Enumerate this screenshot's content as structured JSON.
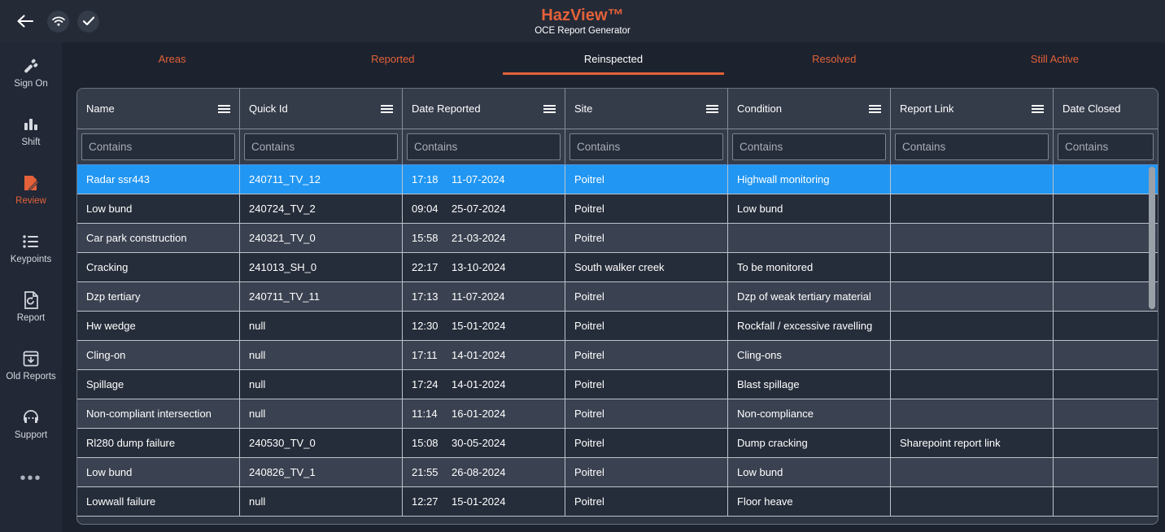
{
  "topbar": {
    "back_icon": "back-arrow-icon",
    "wifi_icon": "wifi-icon",
    "check_icon": "check-icon",
    "brand_title": "HazView™",
    "brand_subtitle": "OCE Report Generator",
    "brand_color": "#e4613a"
  },
  "sidebar": {
    "items": [
      {
        "label": "Sign On",
        "icon": "sign-on-icon",
        "active": false
      },
      {
        "label": "Shift",
        "icon": "bar-chart-icon",
        "active": false
      },
      {
        "label": "Review",
        "icon": "edit-document-icon",
        "active": true
      },
      {
        "label": "Keypoints",
        "icon": "list-icon",
        "active": false
      },
      {
        "label": "Report",
        "icon": "document-refresh-icon",
        "active": false
      },
      {
        "label": "Old Reports",
        "icon": "archive-download-icon",
        "active": false
      },
      {
        "label": "Support",
        "icon": "headset-icon",
        "active": false
      }
    ],
    "more_label": "•••",
    "active_color": "#e4613a"
  },
  "tabs": [
    {
      "label": "Areas",
      "active": false
    },
    {
      "label": "Reported",
      "active": false
    },
    {
      "label": "Reinspected",
      "active": true
    },
    {
      "label": "Resolved",
      "active": false
    },
    {
      "label": "Still Active",
      "active": false
    }
  ],
  "grid": {
    "columns": [
      {
        "label": "Name",
        "menu_icon": "column-menu-icon",
        "has_menu": true
      },
      {
        "label": "Quick Id",
        "menu_icon": "column-menu-icon",
        "has_menu": true
      },
      {
        "label": "Date Reported",
        "menu_icon": "column-menu-icon",
        "has_menu": true
      },
      {
        "label": "Site",
        "menu_icon": "column-menu-icon",
        "has_menu": true
      },
      {
        "label": "Condition",
        "menu_icon": "column-menu-icon",
        "has_menu": true
      },
      {
        "label": "Report Link",
        "menu_icon": "column-menu-icon",
        "has_menu": true
      },
      {
        "label": "Date Closed",
        "menu_icon": "column-menu-icon",
        "has_menu": false
      }
    ],
    "filter_placeholder": "Contains",
    "filter_values": [
      "",
      "",
      "",
      "",
      "",
      "",
      ""
    ],
    "selected_row_index": 0,
    "selected_row_color": "#2196f3",
    "rows": [
      {
        "name": "Radar ssr443",
        "quick_id": "240711_TV_12",
        "time": "17:18",
        "date": "11-07-2024",
        "site": "Poitrel",
        "condition": "Highwall monitoring",
        "report_link": "",
        "date_closed": ""
      },
      {
        "name": "Low bund",
        "quick_id": "240724_TV_2",
        "time": "09:04",
        "date": "25-07-2024",
        "site": "Poitrel",
        "condition": "Low bund",
        "report_link": "",
        "date_closed": ""
      },
      {
        "name": "Car park construction",
        "quick_id": "240321_TV_0",
        "time": "15:58",
        "date": "21-03-2024",
        "site": "Poitrel",
        "condition": "",
        "report_link": "",
        "date_closed": ""
      },
      {
        "name": "Cracking",
        "quick_id": "241013_SH_0",
        "time": "22:17",
        "date": "13-10-2024",
        "site": "South walker creek",
        "condition": "To be monitored",
        "report_link": "",
        "date_closed": ""
      },
      {
        "name": "Dzp tertiary",
        "quick_id": "240711_TV_11",
        "time": "17:13",
        "date": "11-07-2024",
        "site": "Poitrel",
        "condition": "Dzp of weak tertiary material",
        "report_link": "",
        "date_closed": ""
      },
      {
        "name": "Hw wedge",
        "quick_id": "null",
        "time": "12:30",
        "date": "15-01-2024",
        "site": "Poitrel",
        "condition": "Rockfall / excessive ravelling",
        "report_link": "",
        "date_closed": ""
      },
      {
        "name": "Cling-on",
        "quick_id": "null",
        "time": "17:11",
        "date": "14-01-2024",
        "site": "Poitrel",
        "condition": "Cling-ons",
        "report_link": "",
        "date_closed": ""
      },
      {
        "name": "Spillage",
        "quick_id": "null",
        "time": "17:24",
        "date": "14-01-2024",
        "site": "Poitrel",
        "condition": "Blast spillage",
        "report_link": "",
        "date_closed": ""
      },
      {
        "name": "Non-compliant intersection",
        "quick_id": "null",
        "time": "11:14",
        "date": "16-01-2024",
        "site": "Poitrel",
        "condition": "Non-compliance",
        "report_link": "",
        "date_closed": ""
      },
      {
        "name": "Rl280 dump failure",
        "quick_id": "240530_TV_0",
        "time": "15:08",
        "date": "30-05-2024",
        "site": "Poitrel",
        "condition": "Dump cracking",
        "report_link": "Sharepoint report link",
        "date_closed": ""
      },
      {
        "name": "Low bund",
        "quick_id": "240826_TV_1",
        "time": "21:55",
        "date": "26-08-2024",
        "site": "Poitrel",
        "condition": "Low bund",
        "report_link": "",
        "date_closed": ""
      },
      {
        "name": "Lowwall failure",
        "quick_id": "null",
        "time": "12:27",
        "date": "15-01-2024",
        "site": "Poitrel",
        "condition": "Floor heave",
        "report_link": "",
        "date_closed": ""
      }
    ],
    "scrollbar": {
      "name": "vertical-scrollbar"
    }
  }
}
